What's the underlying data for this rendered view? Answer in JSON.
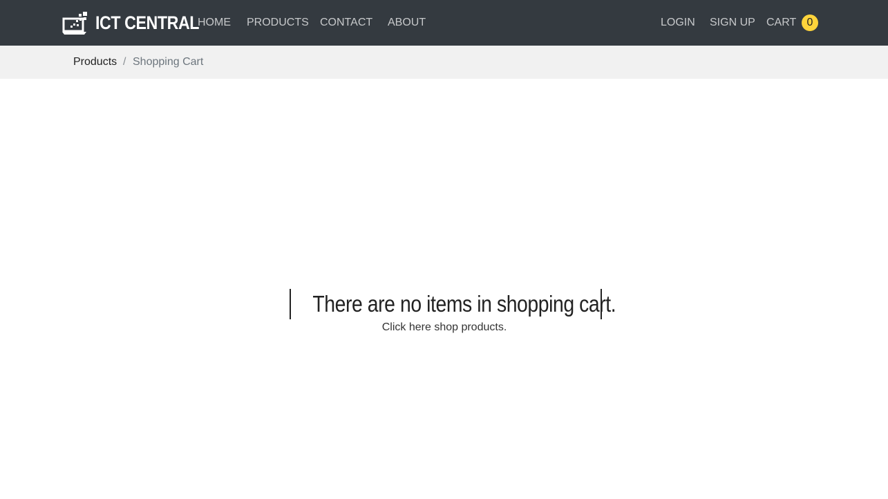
{
  "header": {
    "brand": "ICT CENTRAL",
    "brand_icon": "laptop-pixels-icon",
    "nav_left": {
      "home": "HOME",
      "products": "PRODUCTS",
      "contact": "CONTACT",
      "about": "ABOUT"
    },
    "nav_right": {
      "login": "LOGIN",
      "signup": "SIGN UP",
      "cart": "CART",
      "cart_count": "0"
    }
  },
  "breadcrumb": {
    "link": "Products",
    "separator": "/",
    "current": "Shopping Cart"
  },
  "main": {
    "empty_title": "There are no items in shopping cart.",
    "empty_subtitle": "Click here shop products."
  },
  "colors": {
    "navbar": "#343a40",
    "breadcrumb_bg": "#f1f1f1",
    "badge": "#ffd43b"
  }
}
